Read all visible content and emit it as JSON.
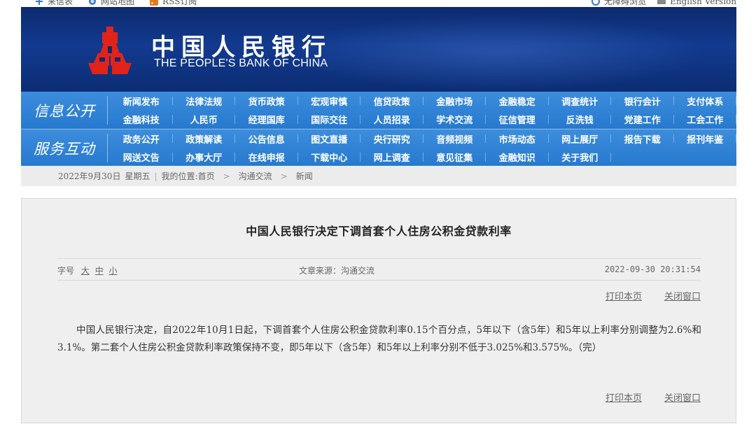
{
  "topbar": {
    "left_items": [
      {
        "icon": "plus-icon",
        "label": "来信表"
      },
      {
        "icon": "globe-icon",
        "label": "网站地图"
      },
      {
        "icon": "rss-icon",
        "label": "RSS订阅"
      }
    ],
    "right_items": [
      {
        "icon": "accessibility-icon",
        "label": "无障碍浏览"
      },
      {
        "icon": "keyboard-icon",
        "label": "English Version"
      }
    ]
  },
  "banner": {
    "logo_cn": "中国人民银行",
    "logo_en": "THE PEOPLE'S BANK OF CHINA",
    "brand_red": "#e2231a",
    "bg_color": "#123a8f"
  },
  "nav": {
    "rows": [
      {
        "category": "信息公开",
        "links": [
          "新闻发布",
          "法律法规",
          "货币政策",
          "宏观审慎",
          "信贷政策",
          "金融市场",
          "金融稳定",
          "调查统计",
          "银行会计",
          "支付体系",
          "金融科技",
          "人民币",
          "经理国库",
          "国际交往",
          "人员招录",
          "学术交流",
          "征信管理",
          "反洗钱",
          "党建工作",
          "工会工作"
        ]
      },
      {
        "category": "服务互动",
        "links": [
          "政务公开",
          "政策解读",
          "公告信息",
          "图文直播",
          "央行研究",
          "音频视频",
          "市场动态",
          "网上展厅",
          "报告下载",
          "报刊年鉴",
          "网送文告",
          "办事大厅",
          "在线申报",
          "下载中心",
          "网上调查",
          "意见征集",
          "金融知识",
          "关于我们",
          "",
          ""
        ]
      }
    ]
  },
  "breadcrumb": {
    "date": "2022年9月30日",
    "weekday": "星期五",
    "location_label": "我的位置:",
    "home": "首页",
    "section": "沟通交流",
    "current": "新闻"
  },
  "article": {
    "title": "中国人民银行决定下调首套个人住房公积金贷款利率",
    "font_size_label": "字号",
    "size_large": "大",
    "size_medium": "中",
    "size_small": "小",
    "source": "文章来源：沟通交流",
    "timestamp": "2022-09-30 20:31:54",
    "print_label": "打印本页",
    "close_label": "关闭窗口",
    "body": "中国人民银行决定，自2022年10月1日起，下调首套个人住房公积金贷款利率0.15个百分点，5年以下（含5年）和5年以上利率分别调整为2.6%和3.1%。第二套个人住房公积金贷款利率政策保持不变，即5年以下（含5年）和5年以上利率分别不低于3.025%和3.575%。（完）"
  }
}
